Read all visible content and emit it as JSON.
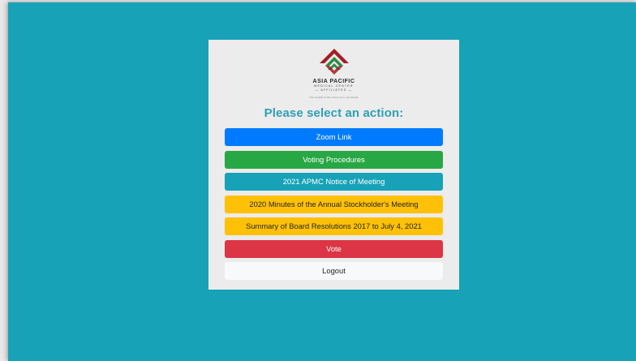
{
  "logo": {
    "name": "ASIA PACIFIC",
    "subtitle": "MEDICAL CENTER",
    "subtitle2": "— AFFILIATES —",
    "tagline": "The health of the nation is in our hands"
  },
  "heading": "Please select an action:",
  "buttons": [
    {
      "label": "Zoom Link",
      "variant": "primary"
    },
    {
      "label": "Voting Procedures",
      "variant": "success"
    },
    {
      "label": "2021 APMC Notice of Meeting",
      "variant": "info"
    },
    {
      "label": "2020 Minutes of the Annual Stockholder's Meeting",
      "variant": "warning"
    },
    {
      "label": "Summary of Board Resolutions 2017 to July 4, 2021",
      "variant": "warning"
    },
    {
      "label": "Vote",
      "variant": "danger"
    },
    {
      "label": "Logout",
      "variant": "light"
    }
  ],
  "colors": {
    "background": "#17a2b8",
    "card": "#ececec",
    "heading": "#2e9fb5",
    "logo_red": "#a51d24",
    "logo_green": "#2e8b47"
  }
}
